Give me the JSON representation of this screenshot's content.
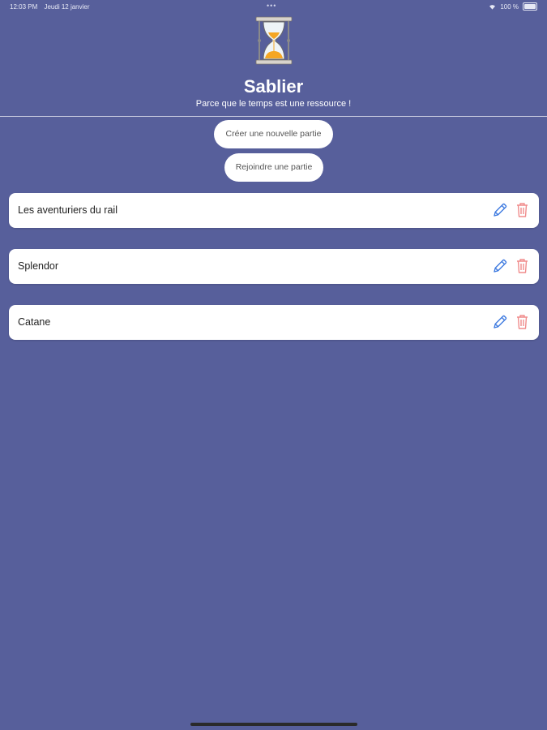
{
  "status_bar": {
    "time": "12:03 PM",
    "date": "Jeudi 12 janvier",
    "dots": "•••",
    "battery": "100 %"
  },
  "header": {
    "logo_icon": "hourglass-icon",
    "title": "Sablier",
    "subtitle": "Parce que le temps est une ressource !"
  },
  "actions": {
    "create_label": "Créer une nouvelle partie",
    "join_label": "Rejoindre une partie"
  },
  "games": [
    {
      "name": "Les aventuriers du rail"
    },
    {
      "name": "Splendor"
    },
    {
      "name": "Catane"
    }
  ],
  "colors": {
    "background": "#575f9b",
    "edit_icon": "#3f7be0",
    "delete_icon": "#f08c8c",
    "sand": "#f5a623"
  }
}
